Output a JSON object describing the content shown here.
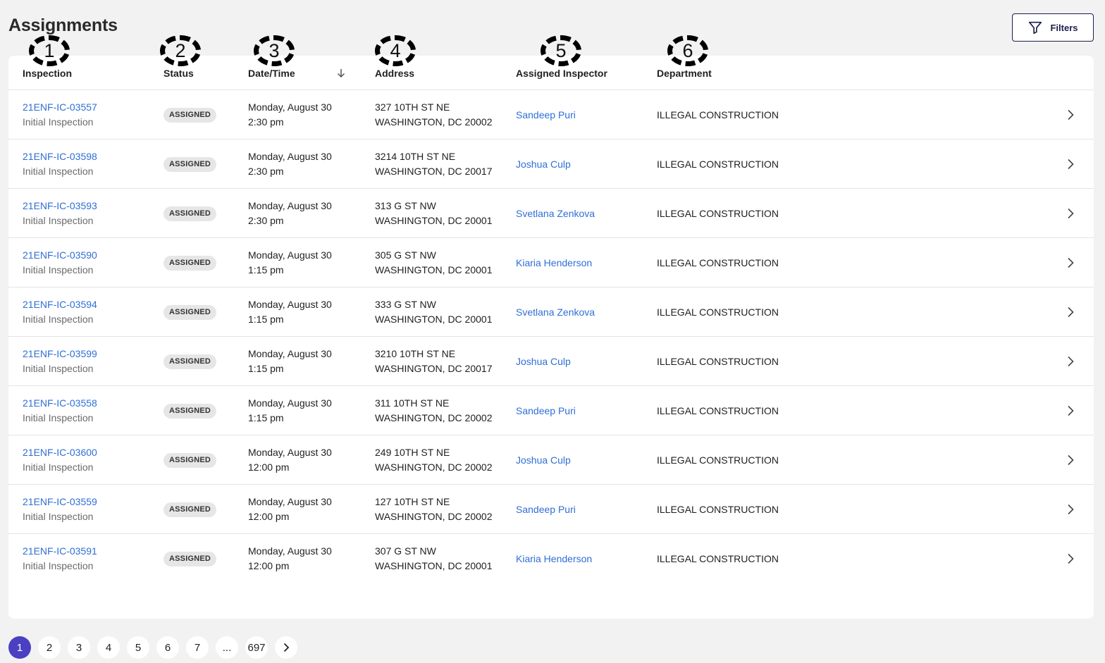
{
  "page": {
    "title": "Assignments",
    "filters_label": "Filters"
  },
  "columns": [
    {
      "label": "Inspection",
      "marker": "1"
    },
    {
      "label": "Status",
      "marker": "2"
    },
    {
      "label": "Date/Time",
      "marker": "3"
    },
    {
      "label": "Address",
      "marker": "4"
    },
    {
      "label": "Assigned Inspector",
      "marker": "5"
    },
    {
      "label": "Department",
      "marker": "6"
    }
  ],
  "rows": [
    {
      "id": "21ENF-IC-03557",
      "type": "Initial Inspection",
      "status": "ASSIGNED",
      "date": "Monday, August 30",
      "time": "2:30 pm",
      "street": "327 10TH ST NE",
      "city": "WASHINGTON, DC 20002",
      "inspector": "Sandeep Puri",
      "department": "ILLEGAL CONSTRUCTION"
    },
    {
      "id": "21ENF-IC-03598",
      "type": "Initial Inspection",
      "status": "ASSIGNED",
      "date": "Monday, August 30",
      "time": "2:30 pm",
      "street": "3214 10TH ST NE",
      "city": "WASHINGTON, DC 20017",
      "inspector": "Joshua Culp",
      "department": "ILLEGAL CONSTRUCTION"
    },
    {
      "id": "21ENF-IC-03593",
      "type": "Initial Inspection",
      "status": "ASSIGNED",
      "date": "Monday, August 30",
      "time": "2:30 pm",
      "street": "313 G ST NW",
      "city": "WASHINGTON, DC 20001",
      "inspector": "Svetlana Zenkova",
      "department": "ILLEGAL CONSTRUCTION"
    },
    {
      "id": "21ENF-IC-03590",
      "type": "Initial Inspection",
      "status": "ASSIGNED",
      "date": "Monday, August 30",
      "time": "1:15 pm",
      "street": "305 G ST NW",
      "city": "WASHINGTON, DC 20001",
      "inspector": "Kiaria Henderson",
      "department": "ILLEGAL CONSTRUCTION"
    },
    {
      "id": "21ENF-IC-03594",
      "type": "Initial Inspection",
      "status": "ASSIGNED",
      "date": "Monday, August 30",
      "time": "1:15 pm",
      "street": "333 G ST NW",
      "city": "WASHINGTON, DC 20001",
      "inspector": "Svetlana Zenkova",
      "department": "ILLEGAL CONSTRUCTION"
    },
    {
      "id": "21ENF-IC-03599",
      "type": "Initial Inspection",
      "status": "ASSIGNED",
      "date": "Monday, August 30",
      "time": "1:15 pm",
      "street": "3210 10TH ST NE",
      "city": "WASHINGTON, DC 20017",
      "inspector": "Joshua Culp",
      "department": "ILLEGAL CONSTRUCTION"
    },
    {
      "id": "21ENF-IC-03558",
      "type": "Initial Inspection",
      "status": "ASSIGNED",
      "date": "Monday, August 30",
      "time": "1:15 pm",
      "street": "311 10TH ST NE",
      "city": "WASHINGTON, DC 20002",
      "inspector": "Sandeep Puri",
      "department": "ILLEGAL CONSTRUCTION"
    },
    {
      "id": "21ENF-IC-03600",
      "type": "Initial Inspection",
      "status": "ASSIGNED",
      "date": "Monday, August 30",
      "time": "12:00 pm",
      "street": "249 10TH ST NE",
      "city": "WASHINGTON, DC 20002",
      "inspector": "Joshua Culp",
      "department": "ILLEGAL CONSTRUCTION"
    },
    {
      "id": "21ENF-IC-03559",
      "type": "Initial Inspection",
      "status": "ASSIGNED",
      "date": "Monday, August 30",
      "time": "12:00 pm",
      "street": "127 10TH ST NE",
      "city": "WASHINGTON, DC 20002",
      "inspector": "Sandeep Puri",
      "department": "ILLEGAL CONSTRUCTION"
    },
    {
      "id": "21ENF-IC-03591",
      "type": "Initial Inspection",
      "status": "ASSIGNED",
      "date": "Monday, August 30",
      "time": "12:00 pm",
      "street": "307 G ST NW",
      "city": "WASHINGTON, DC 20001",
      "inspector": "Kiaria Henderson",
      "department": "ILLEGAL CONSTRUCTION"
    }
  ],
  "pagination": {
    "pages": [
      "1",
      "2",
      "3",
      "4",
      "5",
      "6",
      "7",
      "...",
      "697"
    ],
    "current": "1"
  },
  "icons": {
    "filter": "filter-icon",
    "sort": "arrow-down-icon",
    "row_chevron": "chevron-right-icon",
    "next_page": "chevron-right-icon"
  },
  "colors": {
    "link": "#2f6fd6",
    "active_page": "#4b40c2",
    "filters_border": "#1a1f4d"
  }
}
